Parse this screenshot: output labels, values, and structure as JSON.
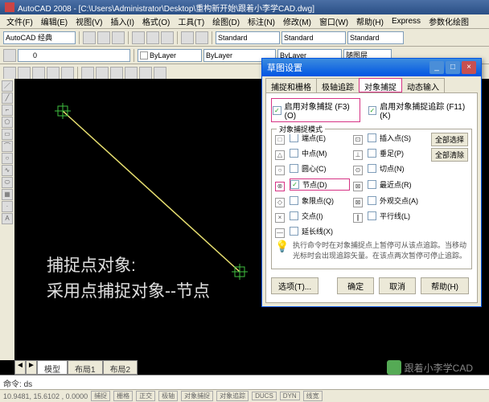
{
  "title": "AutoCAD 2008 - [C:\\Users\\Administrator\\Desktop\\重构新开始\\跟着小李学CAD.dwg]",
  "menu": [
    "文件(F)",
    "编辑(E)",
    "视图(V)",
    "插入(I)",
    "格式(O)",
    "工具(T)",
    "绘图(D)",
    "标注(N)",
    "修改(M)",
    "窗口(W)",
    "帮助(H)",
    "Express",
    "参数化绘图"
  ],
  "workspace_label": "AutoCAD 经典",
  "layer_combo": "ByLayer",
  "style_combo": "Standard",
  "linetype_combo": "ByLayer",
  "color_combo": "随图层",
  "tabs": {
    "nav": [
      "◄",
      "►"
    ],
    "model": "模型",
    "l1": "布局1",
    "l2": "布局2"
  },
  "cmd": {
    "prompt": "命令:",
    "value": "ds"
  },
  "status": {
    "coords": "10.9481, 15.6102 , 0.0000",
    "modes": [
      "捕捉",
      "栅格",
      "正交",
      "极轴",
      "对象捕捉",
      "对象追踪",
      "DUCS",
      "DYN",
      "线宽"
    ]
  },
  "anno": {
    "l1": "捕捉点对象:",
    "l2": "采用点捕捉对象--节点"
  },
  "dialog": {
    "title": "草图设置",
    "tabs": [
      "捕捉和栅格",
      "极轴追踪",
      "对象捕捉",
      "动态输入"
    ],
    "enable_snap": "启用对象捕捉 (F3)(O)",
    "enable_track": "启用对象捕捉追踪 (F11)(K)",
    "fieldset": "对象捕捉模式",
    "snaps": {
      "end": "端点(E)",
      "mid": "中点(M)",
      "cen": "圆心(C)",
      "nod": "节点(D)",
      "qua": "象限点(Q)",
      "int": "交点(I)",
      "ext": "延长线(X)",
      "ins": "插入点(S)",
      "per": "垂足(P)",
      "tan": "切点(N)",
      "nea": "最近点(R)",
      "app": "外观交点(A)",
      "par": "平行线(L)"
    },
    "btn_all": "全部选择",
    "btn_clear": "全部清除",
    "tip": "执行命令时在对象捕捉点上暂停可从该点追踪。当移动光标时会出现追踪矢量。在该点两次暂停可停止追踪。",
    "opt": "选项(T)...",
    "ok": "确定",
    "cancel": "取消",
    "help": "帮助(H)"
  },
  "watermark": "跟着小李学CAD"
}
